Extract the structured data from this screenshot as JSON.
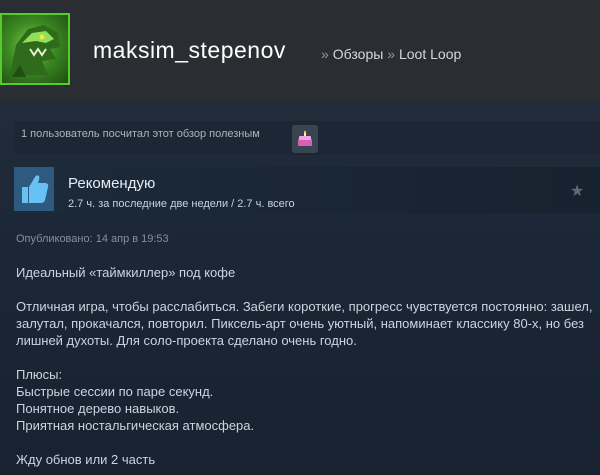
{
  "header": {
    "username": "maksim_stepenov",
    "breadcrumb_sep": "»",
    "breadcrumb_reviews": "Обзоры",
    "breadcrumb_game": "Loot Loop"
  },
  "helpful": {
    "text": "1 пользователь посчитал этот обзор полезным",
    "award_icon": "cake-icon"
  },
  "recommendation": {
    "title": "Рекомендую",
    "hours": "2.7 ч. за последние две недели / 2.7 ч. всего",
    "icon": "thumbs-up-icon"
  },
  "posted": "Опубликовано: 14 апр в 19:53",
  "review": {
    "headline": "Идеальный «таймкиллер» под кофе",
    "paragraph1": "Отличная игра, чтобы расслабиться. Забеги короткие, прогресс чувствуется постоянно: зашел, залутал, прокачался, повторил. Пиксель-арт очень уютный, напоминает классику 80-х, но без лишней духоты. Для соло-проекта сделано очень годно.",
    "pros_title": "Плюсы:",
    "pros": [
      "Быстрые сессии по паре секунд.",
      "Понятное дерево навыков.",
      "Приятная ностальгическая атмосфера."
    ],
    "closing": "Жду обнов или 2 часть"
  },
  "colors": {
    "accent_green": "#57cb2e",
    "background": "#1b2838",
    "thumb_blue": "#67c1f5"
  }
}
